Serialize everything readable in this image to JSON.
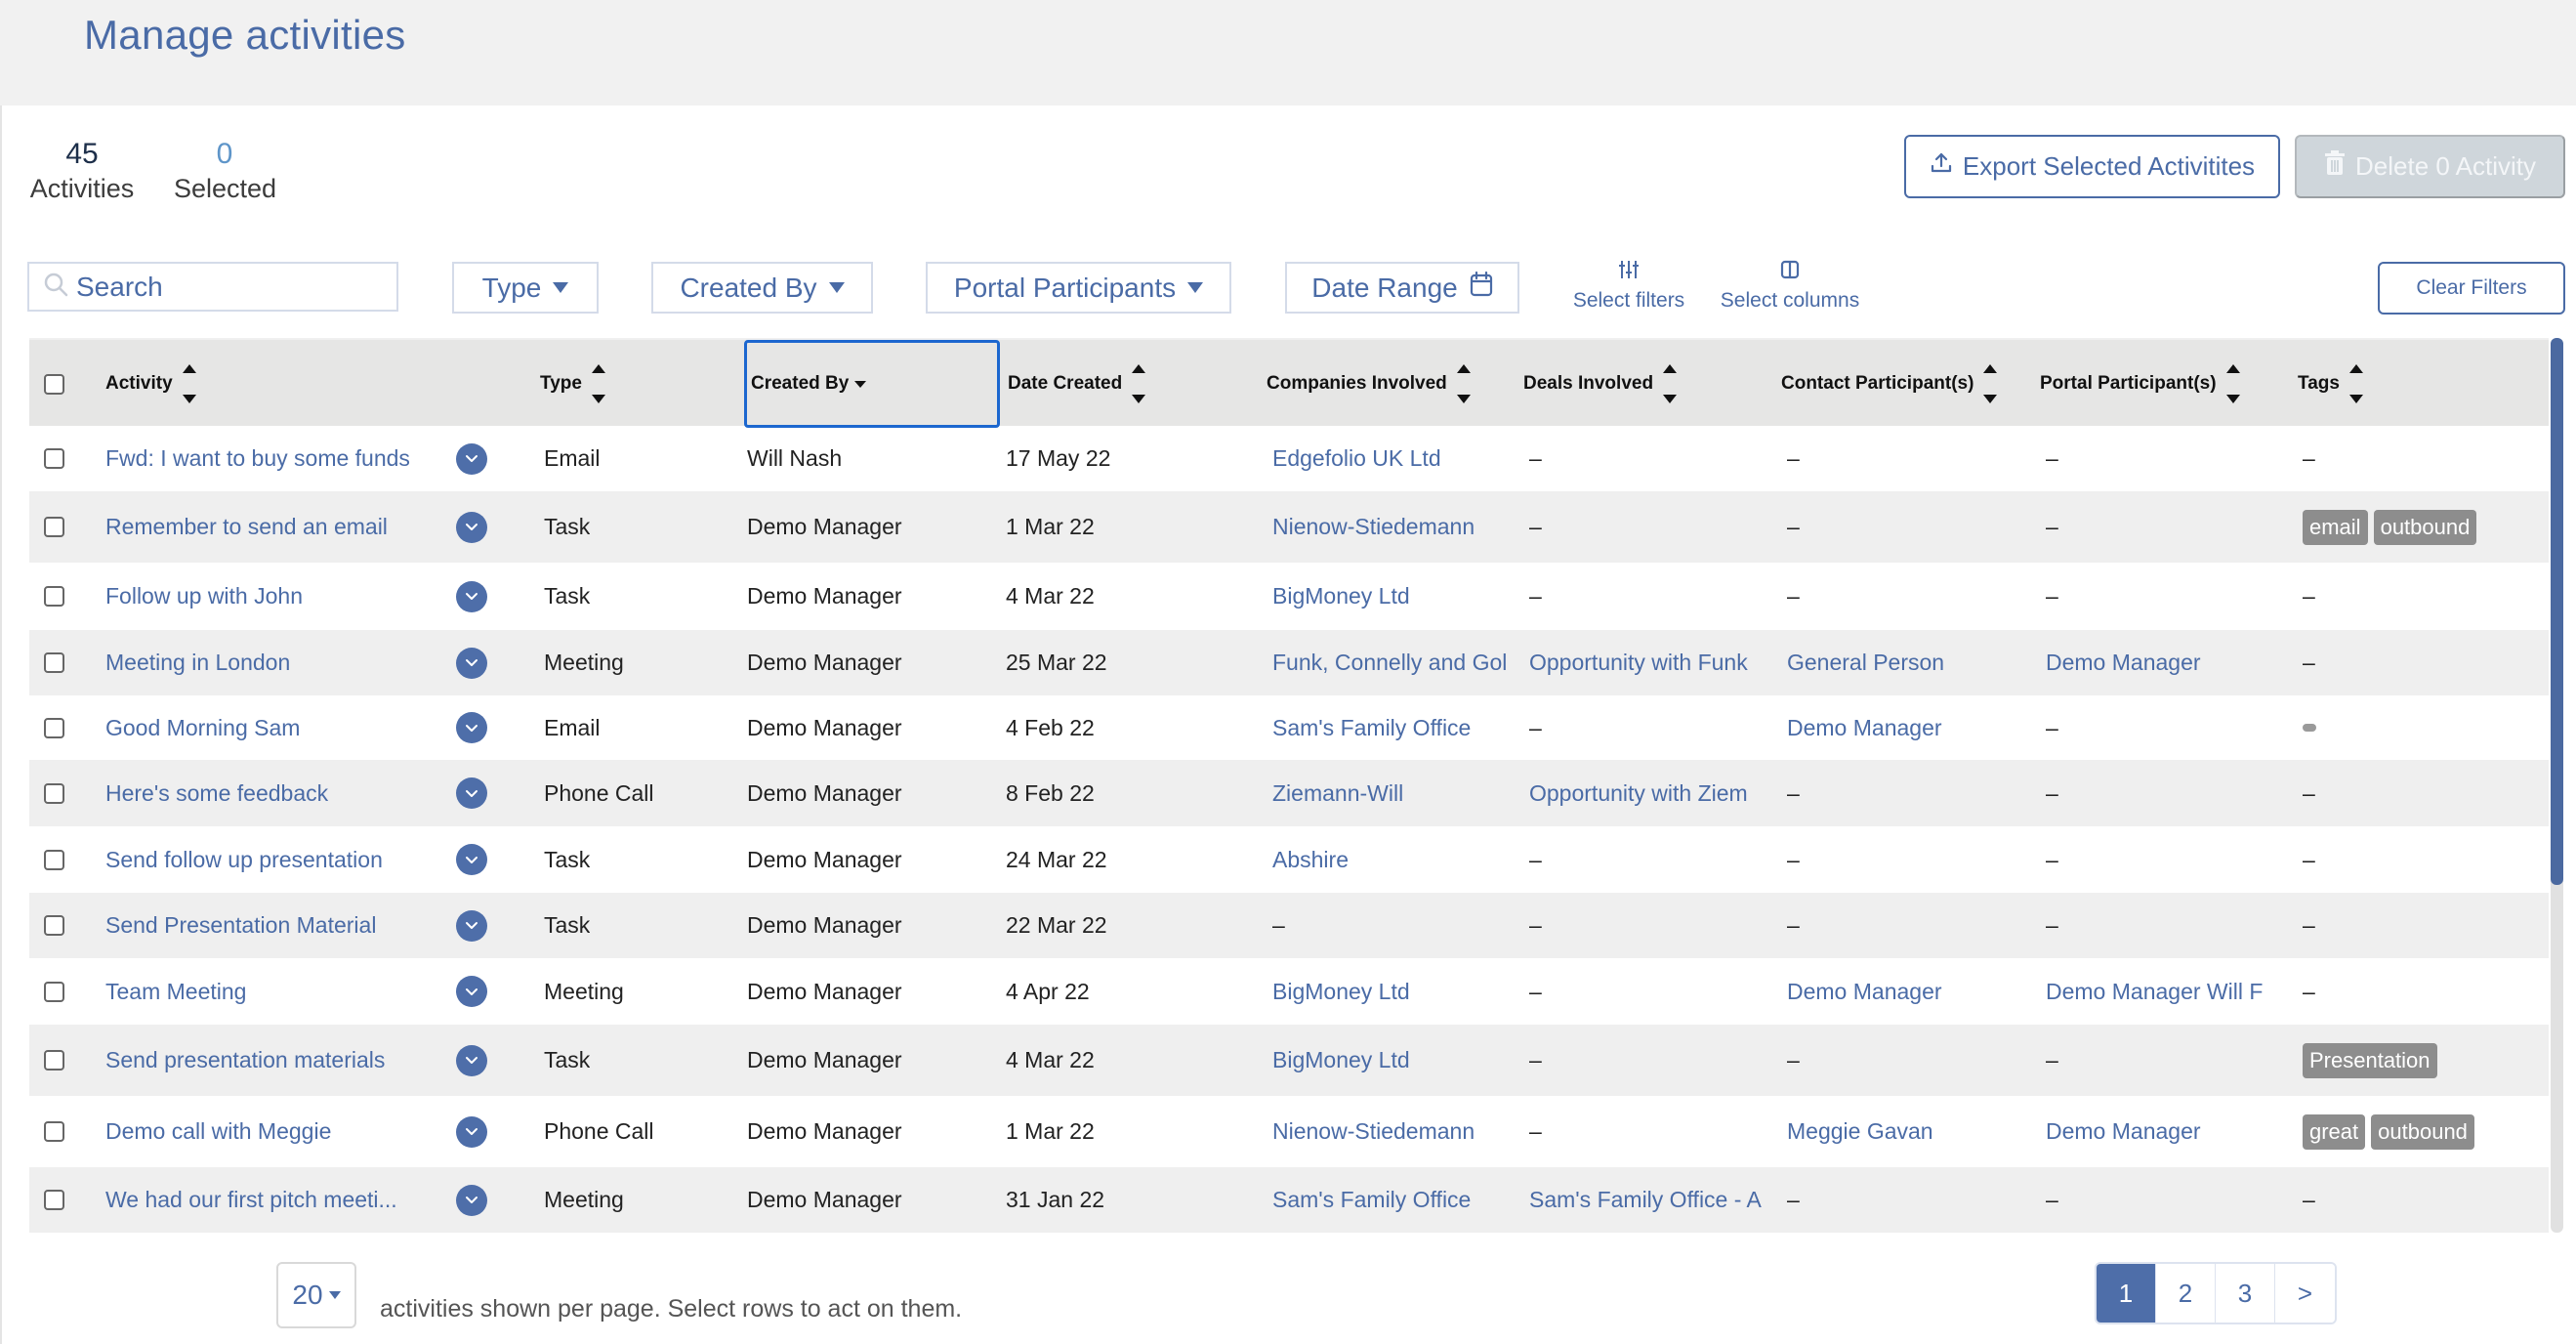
{
  "header": {
    "title": "Manage activities"
  },
  "stats": {
    "total_count": "45",
    "total_label": "Activities",
    "selected_count": "0",
    "selected_label": "Selected"
  },
  "actions": {
    "export_label": "Export Selected Activitites",
    "delete_label": "Delete 0 Activity",
    "clear_filters_label": "Clear Filters"
  },
  "filters": {
    "search_placeholder": "Search",
    "search_value": "",
    "type_label": "Type",
    "created_by_label": "Created By",
    "portal_participants_label": "Portal Participants",
    "date_range_label": "Date Range",
    "select_filters_label": "Select filters",
    "select_columns_label": "Select columns"
  },
  "columns": {
    "activity": "Activity",
    "type": "Type",
    "created_by": "Created By",
    "date_created": "Date Created",
    "companies": "Companies Involved",
    "deals": "Deals Involved",
    "contacts": "Contact Participant(s)",
    "portal": "Portal Participant(s)",
    "tags": "Tags"
  },
  "rows": [
    {
      "activity": "Fwd: I want to buy some funds",
      "type": "Email",
      "created_by": "Will Nash",
      "date": "17 May 22",
      "company": "Edgefolio UK Ltd",
      "deal": "–",
      "contact": "–",
      "portal": "–",
      "tags": []
    },
    {
      "activity": "Remember to send an email",
      "type": "Task",
      "created_by": "Demo Manager",
      "date": "1 Mar 22",
      "company": "Nienow-Stiedemann",
      "deal": "–",
      "contact": "–",
      "portal": "–",
      "tags": [
        "email",
        "outbound"
      ]
    },
    {
      "activity": "Follow up with John",
      "type": "Task",
      "created_by": "Demo Manager",
      "date": "4 Mar 22",
      "company": "BigMoney Ltd",
      "deal": "–",
      "contact": "–",
      "portal": "–",
      "tags": []
    },
    {
      "activity": "Meeting in London",
      "type": "Meeting",
      "created_by": "Demo Manager",
      "date": "25 Mar 22",
      "company": "Funk, Connelly and Gol",
      "deal": "Opportunity with Funk",
      "contact": "General Person",
      "portal": "Demo Manager",
      "tags": []
    },
    {
      "activity": "Good Morning Sam",
      "type": "Email",
      "created_by": "Demo Manager",
      "date": "4 Feb 22",
      "company": "Sam's Family Office",
      "deal": "–",
      "contact": "Demo Manager",
      "portal": "–",
      "tags": [
        ""
      ]
    },
    {
      "activity": "Here's some feedback",
      "type": "Phone Call",
      "created_by": "Demo Manager",
      "date": "8 Feb 22",
      "company": "Ziemann-Will",
      "deal": "Opportunity with Ziem",
      "contact": "–",
      "portal": "–",
      "tags": []
    },
    {
      "activity": "Send follow up presentation",
      "type": "Task",
      "created_by": "Demo Manager",
      "date": "24 Mar 22",
      "company": "Abshire",
      "deal": "–",
      "contact": "–",
      "portal": "–",
      "tags": []
    },
    {
      "activity": "Send Presentation Material",
      "type": "Task",
      "created_by": "Demo Manager",
      "date": "22 Mar 22",
      "company": "–",
      "deal": "–",
      "contact": "–",
      "portal": "–",
      "tags": []
    },
    {
      "activity": "Team Meeting",
      "type": "Meeting",
      "created_by": "Demo Manager",
      "date": "4 Apr 22",
      "company": "BigMoney Ltd",
      "deal": "–",
      "contact": "Demo Manager",
      "portal": "Demo Manager   Will F",
      "tags": []
    },
    {
      "activity": "Send presentation materials",
      "type": "Task",
      "created_by": "Demo Manager",
      "date": "4 Mar 22",
      "company": "BigMoney Ltd",
      "deal": "–",
      "contact": "–",
      "portal": "–",
      "tags": [
        "Presentation"
      ]
    },
    {
      "activity": "Demo call with Meggie",
      "type": "Phone Call",
      "created_by": "Demo Manager",
      "date": "1 Mar 22",
      "company": "Nienow-Stiedemann",
      "deal": "–",
      "contact": "Meggie Gavan",
      "portal": "Demo Manager",
      "tags": [
        "great",
        "outbound"
      ]
    },
    {
      "activity": "We had our first pitch meeti...",
      "type": "Meeting",
      "created_by": "Demo Manager",
      "date": "31 Jan 22",
      "company": "Sam's Family Office",
      "deal": "Sam's Family Office - A",
      "contact": "–",
      "portal": "–",
      "tags": []
    }
  ],
  "empty_value": "–",
  "footer": {
    "per_page_value": "20",
    "per_page_text": "activities shown per page. Select rows to act on them.",
    "pages": [
      "1",
      "2",
      "3",
      ">"
    ],
    "current_page": "1"
  },
  "icons": {
    "export": "upload-icon",
    "delete": "trash-icon",
    "search": "search-icon",
    "date_range": "calendar-icon",
    "select_filters": "sliders-icon",
    "select_columns": "columns-icon",
    "row_toggle": "chevron-down-icon"
  },
  "colors": {
    "brand": "#4a6ba6",
    "focus": "#1c67cf",
    "tag": "#8d8d8d",
    "disabled": "#cfd6db"
  }
}
